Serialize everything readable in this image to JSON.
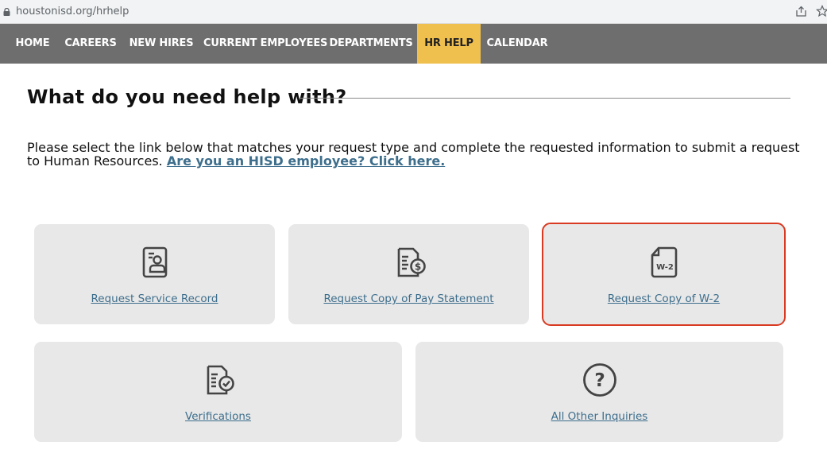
{
  "browser": {
    "url": "houstonisd.org/hrhelp"
  },
  "nav": {
    "items": [
      {
        "label": "HOME"
      },
      {
        "label": "CAREERS"
      },
      {
        "label": "NEW HIRES"
      },
      {
        "label": "CURRENT EMPLOYEES"
      },
      {
        "label": "DEPARTMENTS"
      },
      {
        "label": "HR HELP",
        "active": true
      },
      {
        "label": "CALENDAR"
      }
    ],
    "active_color": "#f0c04f",
    "bg_color": "#6e6e6e"
  },
  "main": {
    "title": "What do you need help with?",
    "intro_text": "Please select the link below that matches your request type and complete the requested information to submit a request to Human Resources. ",
    "intro_link": "Are you an HISD employee? Click here.",
    "cards": [
      {
        "label": "Request Service Record",
        "icon": "id-card-icon"
      },
      {
        "label": "Request Copy of Pay Statement",
        "icon": "pay-statement-icon"
      },
      {
        "label": "Request Copy of W-2",
        "icon": "w2-document-icon",
        "icon_text": "W-2",
        "highlighted": true
      },
      {
        "label": "Verifications",
        "icon": "verification-document-icon"
      },
      {
        "label": "All Other Inquiries",
        "icon": "question-circle-icon",
        "icon_text": "?"
      }
    ],
    "link_color": "#3d6e8c",
    "highlight_color": "#d93a22"
  }
}
